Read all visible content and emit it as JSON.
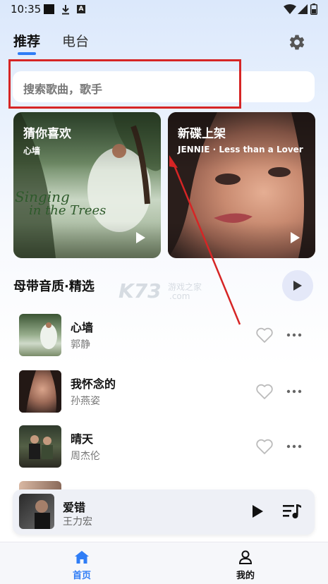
{
  "status_bar": {
    "time": "10:35",
    "a_badge": "A"
  },
  "tabs": [
    {
      "label": "推荐",
      "active": true
    },
    {
      "label": "电台",
      "active": false
    }
  ],
  "search": {
    "placeholder": "搜索歌曲，歌手"
  },
  "cards": [
    {
      "title": "猜你喜欢",
      "subtitle": "心墙",
      "art_text_line1": "Singing",
      "art_text_line2": "in the Trees"
    },
    {
      "title": "新碟上架",
      "subtitle": "JENNIE · Less than a Lover"
    }
  ],
  "section": {
    "title": "母带音质·精选"
  },
  "watermark": {
    "brand": "K73",
    "site": "游戏之家",
    "domain": ".com"
  },
  "songs": [
    {
      "title": "心墙",
      "artist": "郭静"
    },
    {
      "title": "我怀念的",
      "artist": "孙燕姿"
    },
    {
      "title": "晴天",
      "artist": "周杰伦"
    }
  ],
  "now_playing": {
    "title": "爱错",
    "artist": "王力宏"
  },
  "bottom_nav": [
    {
      "label": "首页",
      "active": true
    },
    {
      "label": "我的",
      "active": false
    }
  ],
  "colors": {
    "accent": "#2f7df6",
    "annotation": "#d62525"
  }
}
